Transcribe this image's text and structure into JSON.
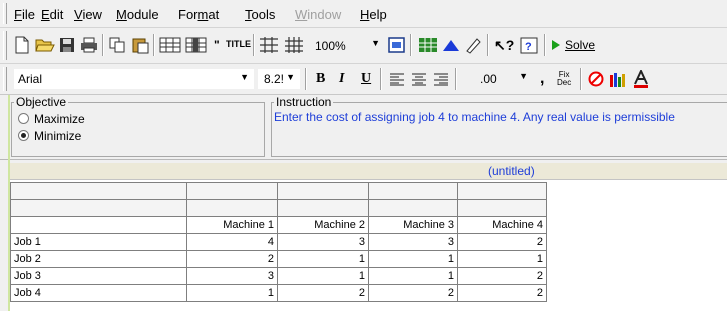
{
  "menu": {
    "items": [
      {
        "label": "File",
        "enabled": true
      },
      {
        "label": "Edit",
        "enabled": true
      },
      {
        "label": "View",
        "enabled": true
      },
      {
        "label": "Module",
        "enabled": true
      },
      {
        "label": "Format",
        "enabled": true
      },
      {
        "label": "Tools",
        "enabled": true
      },
      {
        "label": "Window",
        "enabled": false
      },
      {
        "label": "Help",
        "enabled": true
      }
    ]
  },
  "toolbar": {
    "title_button_label": "TITLE",
    "zoom_value": "100%",
    "solve_label": "Solve"
  },
  "format_bar": {
    "font_name": "Arial",
    "font_size": "8.2!",
    "bold_label": "B",
    "italic_label": "I",
    "underline_label": "U",
    "decimal_value": ".00",
    "comma_label": ",",
    "fix_dec_label_top": "Fix",
    "fix_dec_label_bottom": "Dec"
  },
  "objective": {
    "legend": "Objective",
    "options": [
      {
        "label": "Maximize",
        "selected": false
      },
      {
        "label": "Minimize",
        "selected": true
      }
    ]
  },
  "instruction": {
    "legend": "Instruction",
    "text": "Enter the cost of assigning job 4 to machine 4. Any real value is permissible"
  },
  "grid": {
    "title": "(untitled)",
    "columns": [
      "Machine 1",
      "Machine 2",
      "Machine 3",
      "Machine 4"
    ],
    "rows": [
      {
        "label": "Job 1",
        "values": [
          "4",
          "3",
          "3",
          "2"
        ]
      },
      {
        "label": "Job 2",
        "values": [
          "2",
          "1",
          "1",
          "1"
        ]
      },
      {
        "label": "Job 3",
        "values": [
          "3",
          "1",
          "1",
          "2"
        ]
      },
      {
        "label": "Job 4",
        "values": [
          "1",
          "2",
          "2",
          "2"
        ]
      }
    ]
  },
  "colors": {
    "instruction_text": "#1e3ed8",
    "title_text": "#1e3ed8",
    "solve_arrow": "#1aa01a"
  }
}
